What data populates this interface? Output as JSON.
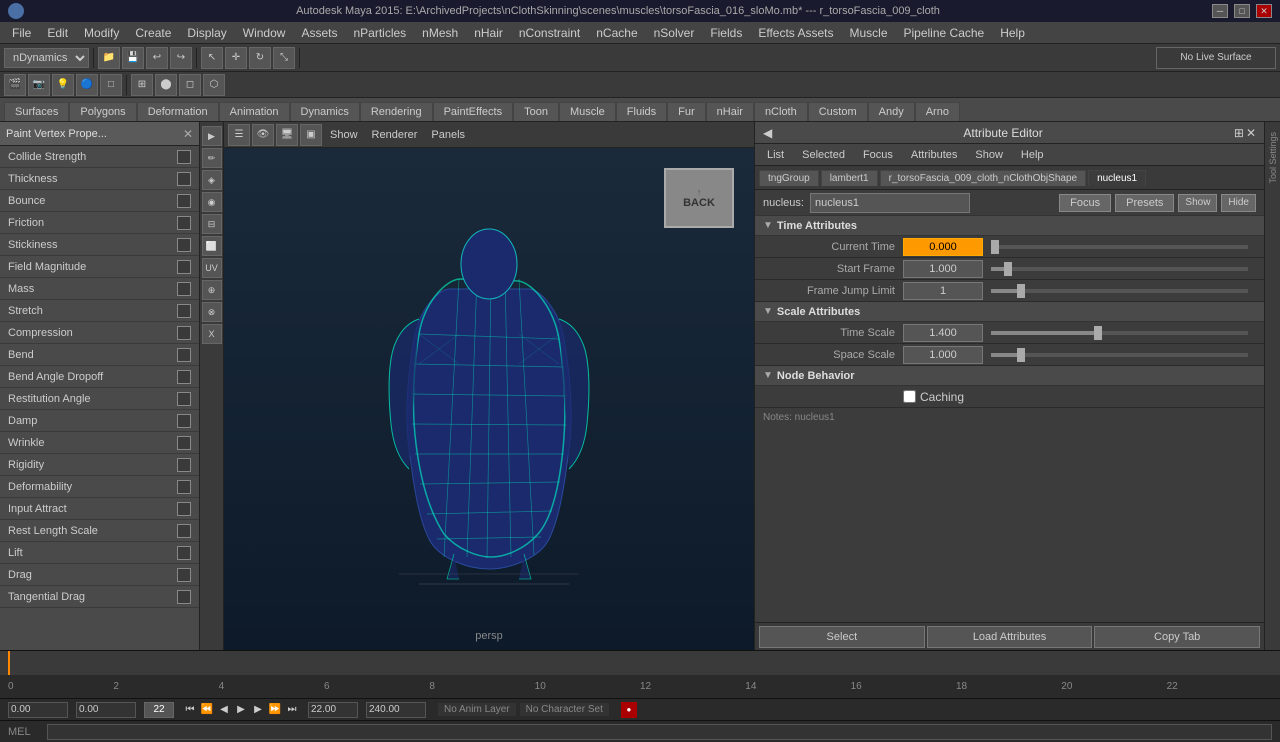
{
  "titlebar": {
    "title": "Autodesk Maya 2015: E:\\ArchivedProjects\\nClothSkinning\\scenes\\muscles\\torsoFascia_016_sloMo.mb*  ---  r_torsoFascia_009_cloth",
    "min_label": "─",
    "max_label": "□",
    "close_label": "✕"
  },
  "menubar": {
    "items": [
      "File",
      "Edit",
      "Modify",
      "Create",
      "Display",
      "Window",
      "Assets",
      "nParticles",
      "nMesh",
      "nHair",
      "nConstraint",
      "nCache",
      "nSolver",
      "Fields",
      "Effects Assets",
      "Muscle",
      "Pipeline Cache",
      "Help"
    ]
  },
  "toolbar": {
    "mode_dropdown": "nDynamics",
    "live_surface": "No Live Surface"
  },
  "tabs": {
    "items": [
      "Surfaces",
      "Polygons",
      "Deformation",
      "Animation",
      "Dynamics",
      "Rendering",
      "PaintEffects",
      "Toon",
      "Muscle",
      "Fluids",
      "Fur",
      "nHair",
      "nCloth",
      "Custom",
      "Andy",
      "Arno"
    ]
  },
  "left_panel": {
    "title": "Paint Vertex Prope...",
    "close_label": "✕",
    "items": [
      {
        "label": "Collide Strength",
        "checked": false
      },
      {
        "label": "Thickness",
        "checked": false
      },
      {
        "label": "Bounce",
        "checked": false
      },
      {
        "label": "Friction",
        "checked": false
      },
      {
        "label": "Stickiness",
        "checked": false
      },
      {
        "label": "Field Magnitude",
        "checked": false
      },
      {
        "label": "Mass",
        "checked": false
      },
      {
        "label": "Stretch",
        "checked": false
      },
      {
        "label": "Compression",
        "checked": false
      },
      {
        "label": "Bend",
        "checked": false
      },
      {
        "label": "Bend Angle Dropoff",
        "checked": false
      },
      {
        "label": "Restitution Angle",
        "checked": false
      },
      {
        "label": "Damp",
        "checked": false
      },
      {
        "label": "Wrinkle",
        "checked": false
      },
      {
        "label": "Rigidity",
        "checked": false
      },
      {
        "label": "Deformability",
        "checked": false
      },
      {
        "label": "Input Attract",
        "checked": false
      },
      {
        "label": "Rest Length Scale",
        "checked": false
      },
      {
        "label": "Lift",
        "checked": false
      },
      {
        "label": "Drag",
        "checked": false
      },
      {
        "label": "Tangential Drag",
        "checked": false
      }
    ]
  },
  "viewport": {
    "label": "persp"
  },
  "back_cube": {
    "label": "BACK"
  },
  "attribute_editor": {
    "title": "Attribute Editor",
    "menu_items": [
      "List",
      "Selected",
      "Focus",
      "Attributes",
      "Show",
      "Help"
    ],
    "tabs": [
      "tngGroup",
      "lambert1",
      "r_torsoFascia_009_cloth_nClothObjShape",
      "nucleus1"
    ],
    "active_tab": "nucleus1",
    "nucleus_label": "nucleus:",
    "nucleus_value": "nucleus1",
    "focus_btn": "Focus",
    "presets_btn": "Presets",
    "show_btn": "Show",
    "hide_btn": "Hide",
    "sections": {
      "time_attributes": {
        "title": "Time Attributes",
        "current_time_label": "Current Time",
        "current_time_value": "0.000",
        "start_frame_label": "Start Frame",
        "start_frame_value": "1.000",
        "frame_jump_label": "Frame Jump Limit",
        "frame_jump_value": "1"
      },
      "scale_attributes": {
        "title": "Scale Attributes",
        "time_scale_label": "Time Scale",
        "time_scale_value": "1.400",
        "space_scale_label": "Space Scale",
        "space_scale_value": "1.000"
      },
      "node_behavior": {
        "title": "Node Behavior",
        "caching_label": "Caching",
        "caching_checked": false
      }
    },
    "notes": "Notes:  nucleus1",
    "bottom_buttons": {
      "select_label": "Select",
      "load_label": "Load Attributes",
      "copy_label": "Copy Tab"
    }
  },
  "timeline": {
    "start": "0",
    "markers": [
      "0",
      "2",
      "4",
      "6",
      "8",
      "10",
      "12",
      "14",
      "16",
      "18",
      "20",
      "22"
    ],
    "current_frame_left": "0.00",
    "current_frame_right": "0.00",
    "frame_input": "22",
    "end_frame": "22.00",
    "end_time": "240.00",
    "anim_layer": "No Anim Layer",
    "character_set": "No Character Set"
  },
  "mel_bar": {
    "label": "MEL"
  },
  "colors": {
    "accent_orange": "#ff9900",
    "bg_dark": "#2a2a2a",
    "bg_mid": "#3c3c3c",
    "bg_light": "#4a4a4a",
    "border": "#222222"
  }
}
